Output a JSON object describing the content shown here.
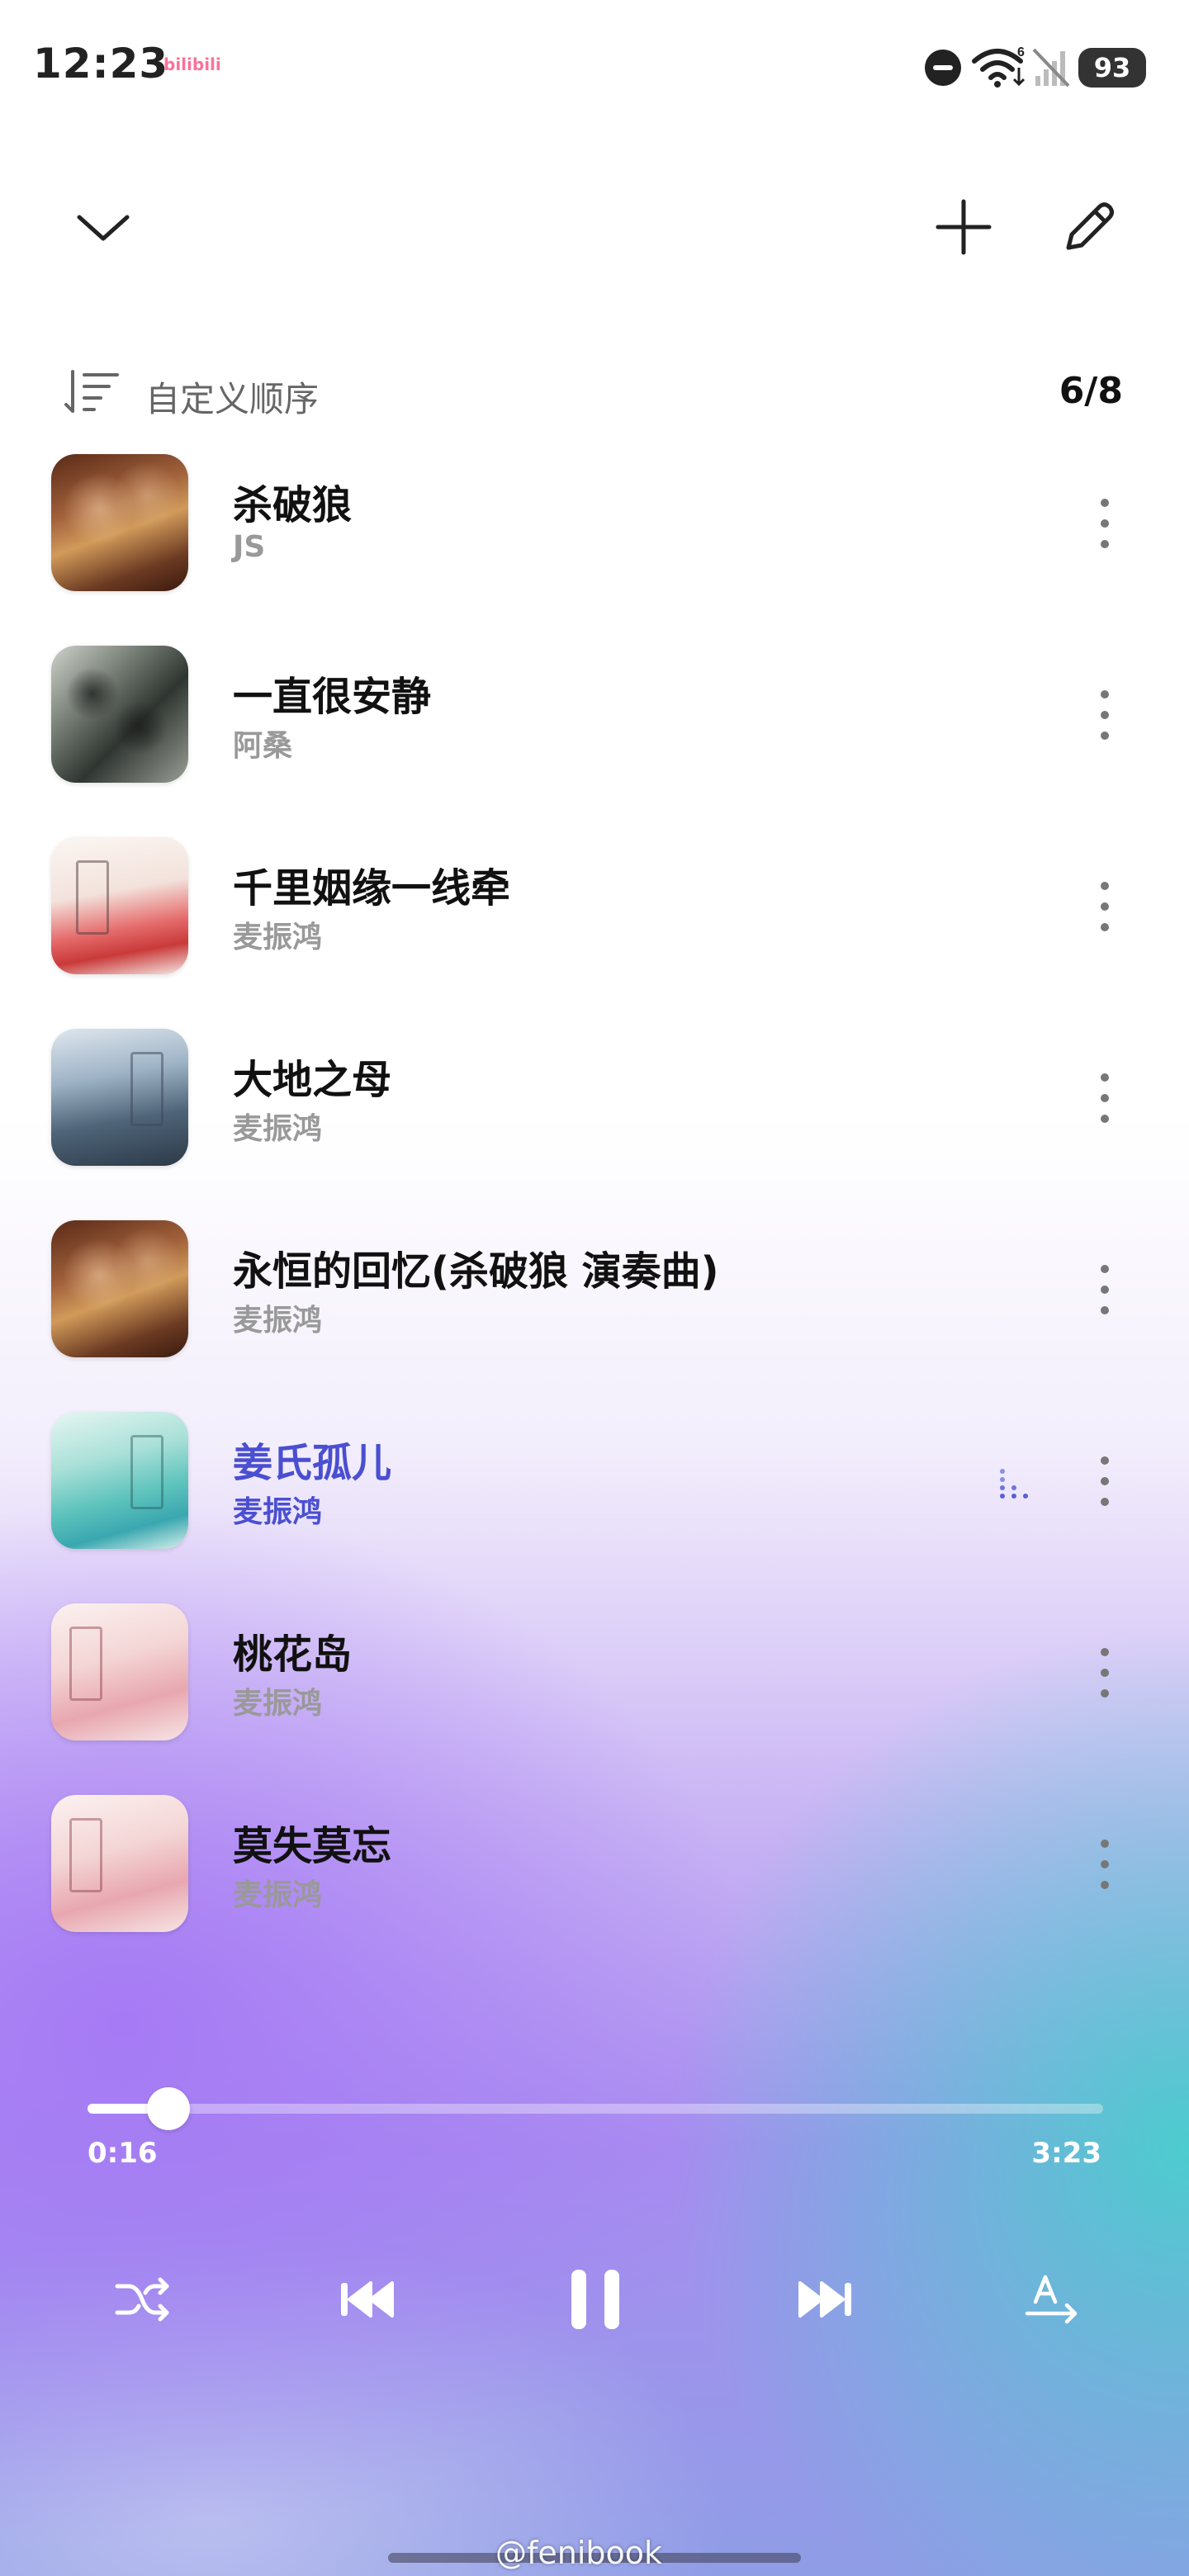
{
  "status_bar": {
    "time": "12:23",
    "app_badge": "bilibili",
    "battery": "93"
  },
  "header": {
    "collapse_icon": "chevron-down-icon",
    "add_icon": "plus-icon",
    "edit_icon": "pencil-icon"
  },
  "queue": {
    "sort_label": "自定义顺序",
    "count": "6/8"
  },
  "songs": [
    {
      "title": "杀破狼",
      "artist": "JS"
    },
    {
      "title": "一直很安静",
      "artist": "阿桑"
    },
    {
      "title": "千里姻缘一线牵",
      "artist": "麦振鸿"
    },
    {
      "title": "大地之母",
      "artist": "麦振鸿"
    },
    {
      "title": "永恒的回忆(杀破狼 演奏曲)",
      "artist": "麦振鸿"
    },
    {
      "title": "姜氏孤儿",
      "artist": "麦振鸿",
      "playing": true
    },
    {
      "title": "桃花岛",
      "artist": "麦振鸿"
    },
    {
      "title": "莫失莫忘",
      "artist": "麦振鸿"
    }
  ],
  "player": {
    "current_time": "0:16",
    "total_time": "3:23",
    "progress": 0.08
  },
  "watermark": "@fenibook",
  "colors": {
    "accent": "#4a4fd1",
    "bilibili": "#fb7299"
  }
}
